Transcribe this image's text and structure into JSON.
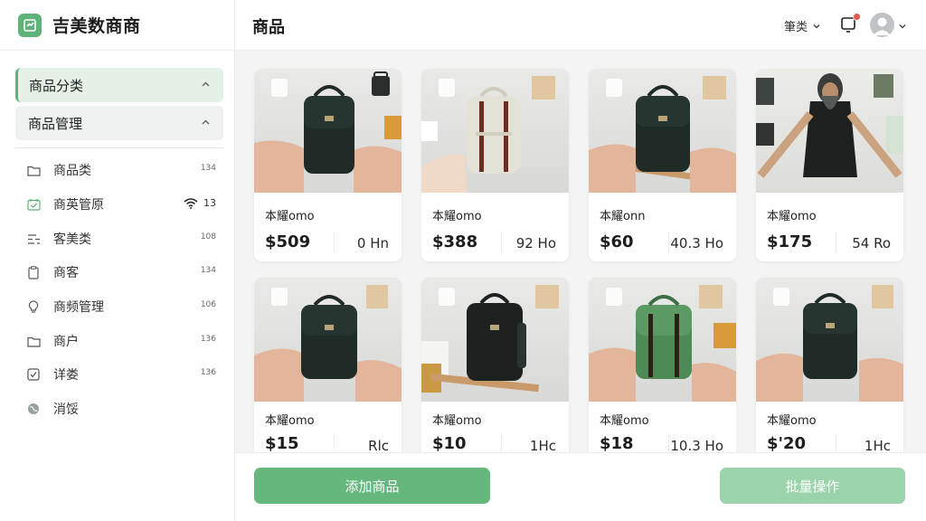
{
  "app": {
    "name": "吉美数商商",
    "logo_icon": "store-logo-icon"
  },
  "sidebar": {
    "groups": [
      {
        "label": "商品分类",
        "active": true
      },
      {
        "label": "商品管理",
        "active": false
      }
    ],
    "items": [
      {
        "label": "商品类",
        "count": "134",
        "icon": "folder-icon"
      },
      {
        "label": "商英管原",
        "count": "13",
        "icon": "calendar-icon",
        "extra_icon": "wifi-icon"
      },
      {
        "label": "客美类",
        "count": "108",
        "icon": "list-icon"
      },
      {
        "label": "商客",
        "count": "134",
        "icon": "clipboard-icon"
      },
      {
        "label": "商频管理",
        "count": "106",
        "icon": "bulb-icon"
      },
      {
        "label": "商户",
        "count": "136",
        "icon": "folder-icon"
      },
      {
        "label": "详娄",
        "count": "136",
        "icon": "check-icon"
      },
      {
        "label": "消馁",
        "count": "",
        "icon": "globe-icon"
      }
    ]
  },
  "header": {
    "title": "商品",
    "filter_label": "筆类",
    "notifications_icon": "bell-icon",
    "avatar_icon": "user-avatar-icon"
  },
  "products": [
    {
      "name": "本耀omo",
      "price": "$509",
      "meta": "0 Hn",
      "bag_color": "#1f2b27",
      "scene": "hands-dark-bag"
    },
    {
      "name": "本耀omo",
      "price": "$388",
      "meta": "92 Ho",
      "bag_color": "#e4e1d6",
      "scene": "hand-white-bag"
    },
    {
      "name": "本耀onn",
      "price": "$60",
      "meta": "40.3 Ho",
      "bag_color": "#1f2b27",
      "scene": "hands-dark-bag"
    },
    {
      "name": "本耀omo",
      "price": "$175",
      "meta": "54 Ro",
      "bag_color": "#2b2b2b",
      "scene": "person-model"
    },
    {
      "name": "本耀omo",
      "price": "$15",
      "meta": "Rlc",
      "bag_color": "#1f2b27",
      "scene": "hands-dark-bag"
    },
    {
      "name": "本耀omo",
      "price": "$10",
      "meta": "1Hc",
      "bag_color": "#1d2220",
      "scene": "table-dark-bag"
    },
    {
      "name": "本耀omo",
      "price": "$18",
      "meta": "10.3 Ho",
      "bag_color": "#4e8a55",
      "scene": "hands-green-bag"
    },
    {
      "name": "本耀omo",
      "price": "$'20",
      "meta": "1Hc",
      "bag_color": "#1f2b27",
      "scene": "hands-dark-bag"
    }
  ],
  "actions": {
    "add_label": "添加商品",
    "batch_label": "批量操作"
  },
  "colors": {
    "accent": "#5fb37a",
    "button": "#65b77d",
    "button_light": "#9bd3aa"
  }
}
